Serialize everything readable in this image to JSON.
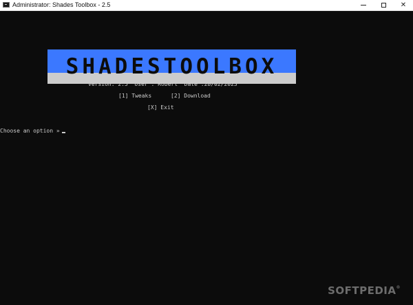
{
  "window": {
    "title": "Administrator: Shades Toolbox - 2.5",
    "controls": {
      "minimize": "—",
      "maximize": "☐",
      "close": "✕"
    }
  },
  "console": {
    "banner": {
      "text": "SHADESTOOLBOX",
      "colors": {
        "top": "#3b78ff",
        "bottom": "#cccccc"
      }
    },
    "info_line": "Version: 2.5  User : Robert  Date :28/02/2023",
    "menu": {
      "tweaks": "[1] Tweaks",
      "download": "[2] Download",
      "exit": "[X] Exit"
    },
    "prompt": "Choose an option »",
    "text_color": "#cccccc",
    "background": "#0c0c0c"
  },
  "watermark": {
    "text": "SOFTPEDIA",
    "mark": "®"
  }
}
